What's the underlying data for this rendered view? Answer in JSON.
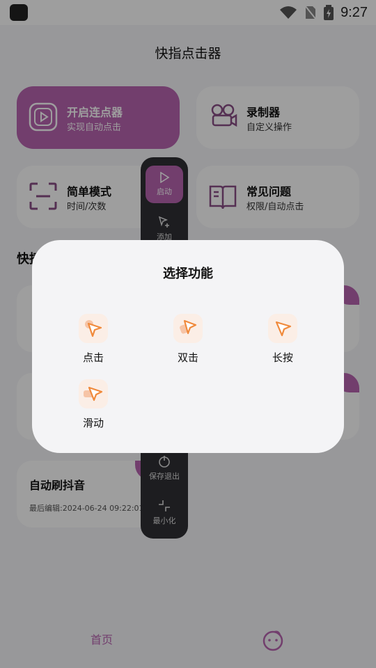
{
  "status": {
    "time": "9:27"
  },
  "app": {
    "title": "快指点击器",
    "cards": [
      {
        "title": "开启连点器",
        "sub": "实现自动点击"
      },
      {
        "title": "录制器",
        "sub": "自定义操作"
      },
      {
        "title": "简单模式",
        "sub": "时间/次数"
      },
      {
        "title": "常见问题",
        "sub": "权限/自动点击"
      }
    ],
    "section_title": "快捷",
    "scripts": [
      {
        "name": "自动刷抖音",
        "date": "最后编辑:2024-06-24 09:22:01"
      }
    ]
  },
  "panel": {
    "items": [
      {
        "label": "启动"
      },
      {
        "label": "添加"
      },
      {
        "label": "保存退出"
      },
      {
        "label": "最小化"
      }
    ]
  },
  "dialog": {
    "title": "选择功能",
    "options": [
      {
        "label": "点击"
      },
      {
        "label": "双击"
      },
      {
        "label": "长按"
      },
      {
        "label": "滑动"
      }
    ]
  },
  "nav": {
    "home": "首页"
  },
  "colors": {
    "accent": "#b864b1",
    "icon_orange": "#f08a3c"
  }
}
